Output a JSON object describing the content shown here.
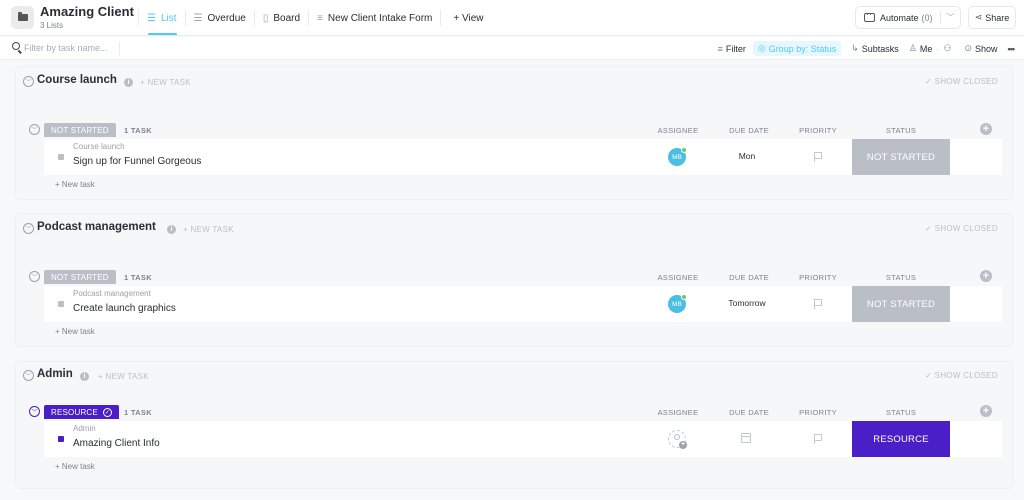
{
  "header": {
    "title": "Amazing Client",
    "subtitle": "3 Lists",
    "folder_icon": "folder-icon",
    "views": [
      {
        "label": "List",
        "icon": "list-icon",
        "active": true
      },
      {
        "label": "Overdue",
        "icon": "list-icon",
        "active": false
      },
      {
        "label": "Board",
        "icon": "board-icon",
        "active": false
      },
      {
        "label": "New Client Intake Form",
        "icon": "form-icon",
        "active": false
      }
    ],
    "add_view_label": "+ View",
    "automate_label": "Automate",
    "automate_count": "(0)",
    "share_label": "Share"
  },
  "toolbar": {
    "search_placeholder": "Filter by task name...",
    "filter_label": "Filter",
    "group_by_label": "Group by: Status",
    "subtasks_label": "Subtasks",
    "me_label": "Me",
    "show_label": "Show",
    "more_label": "•••"
  },
  "colors": {
    "accent": "#49ccf9",
    "not_started": "#b9bec7",
    "resource": "#4a1fc7"
  },
  "columns": {
    "assignee": "ASSIGNEE",
    "due_date": "DUE DATE",
    "priority": "PRIORITY",
    "status": "STATUS"
  },
  "lists": [
    {
      "title": "Course launch",
      "new_task_label": "+ NEW TASK",
      "show_closed_label": "✓ SHOW CLOSED",
      "group": {
        "status": "NOT STARTED",
        "count": "1 TASK",
        "color": "#b9bec7"
      },
      "task": {
        "parent": "Course launch",
        "name": "Sign up for Funnel Gorgeous",
        "assignee_initials": "MB",
        "due": "Mon",
        "status": "NOT STARTED"
      },
      "new_task_row": "+ New task"
    },
    {
      "title": "Podcast management",
      "new_task_label": "+ NEW TASK",
      "show_closed_label": "✓ SHOW CLOSED",
      "group": {
        "status": "NOT STARTED",
        "count": "1 TASK",
        "color": "#b9bec7"
      },
      "task": {
        "parent": "Podcast management",
        "name": "Create launch graphics",
        "assignee_initials": "MB",
        "due": "Tomorrow",
        "status": "NOT STARTED"
      },
      "new_task_row": "+ New task"
    },
    {
      "title": "Admin",
      "new_task_label": "+ NEW TASK",
      "show_closed_label": "✓ SHOW CLOSED",
      "group": {
        "status": "RESOURCE",
        "count": "1 TASK",
        "color": "#4a1fc7"
      },
      "task": {
        "parent": "Admin",
        "name": "Amazing Client Info",
        "assignee_initials": "",
        "due": "",
        "status": "RESOURCE"
      },
      "new_task_row": "+ New task"
    }
  ]
}
